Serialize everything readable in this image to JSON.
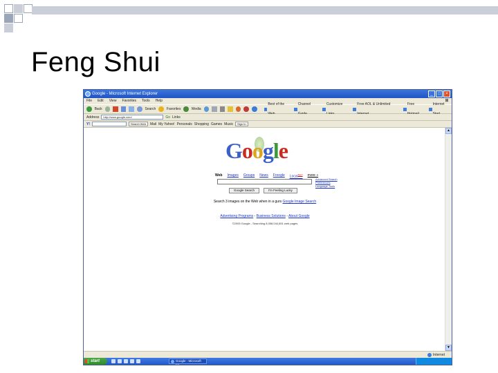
{
  "slide": {
    "title": "Feng Shui"
  },
  "browser": {
    "title": "Google - Microsoft Internet Explorer",
    "menu": [
      "File",
      "Edit",
      "View",
      "Favorites",
      "Tools",
      "Help"
    ],
    "toolbar": {
      "back": "Back",
      "search": "Search",
      "favorites": "Favorites",
      "media": "Media"
    },
    "toolbar_links": [
      "Best of the Web",
      "Channel Guide",
      "Customize Links",
      "Free AOL & Unlimited Internet",
      "Free Hotmail",
      "Internet Start"
    ],
    "address": {
      "label": "Address",
      "url": "http://www.google.com/",
      "go": "Go",
      "links": "Links"
    },
    "google_toolbar": {
      "search_web": "Search Web",
      "items": [
        "Mail",
        "My Yahoo!",
        "Personals",
        "Shopping",
        "Games",
        "Music",
        "Sign In"
      ]
    },
    "status": {
      "zone": "Internet"
    },
    "taskbar": {
      "start": "start",
      "task": "Google - Microsoft Int..."
    }
  },
  "google": {
    "logo_letters": [
      "G",
      "o",
      "o",
      "g",
      "l",
      "e"
    ],
    "tabs": [
      "Web",
      "Images",
      "Groups",
      "News",
      "Froogle",
      "Local",
      "more »"
    ],
    "local_badge": "New!",
    "side_links": [
      "Advanced Search",
      "Preferences",
      "Language Tools"
    ],
    "buttons": {
      "search": "Google Search",
      "lucky": "I'm Feeling Lucky"
    },
    "promo": {
      "text": "Search 3 images on the Web when in a gurs ",
      "link": "Google Image Search"
    },
    "footer": {
      "links": [
        "Advertising Programs",
        "Business Solutions",
        "About Google"
      ]
    },
    "copyright": "©2005 Google - Searching 8,058,044,651 web pages"
  },
  "colors": {
    "google_blue": "#3b5fc8",
    "google_red": "#c62d1f",
    "google_yellow": "#e0a31c",
    "google_green": "#3a9a3a",
    "titlebar_blue": "#2458c9",
    "deco_gray": "#c9ced8"
  }
}
